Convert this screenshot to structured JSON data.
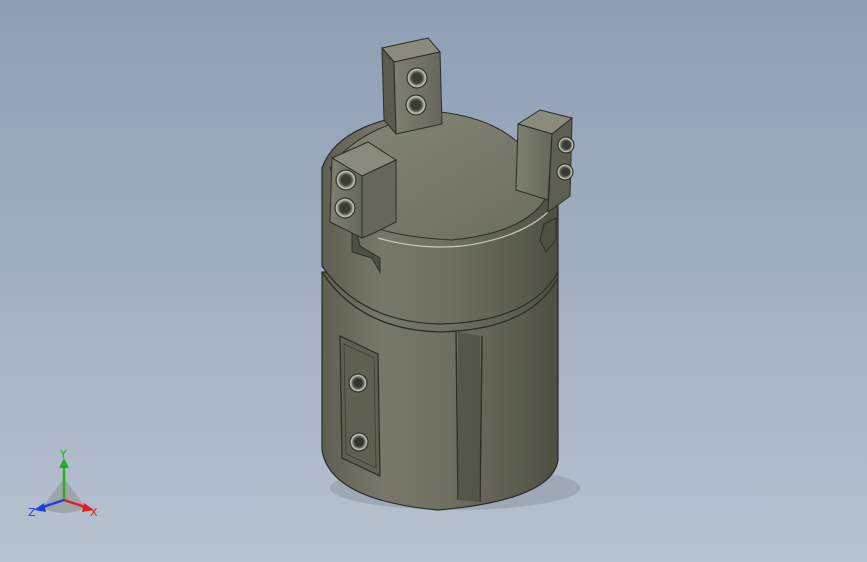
{
  "viewport": {
    "background_top": "#8f9fb4",
    "background_bottom": "#b7c2d0"
  },
  "model": {
    "body_color": "#6b6b5b",
    "body_shadow": "#55564a",
    "body_highlight": "#8c8c7a",
    "top_face_color": "#7b7b6b",
    "jaw_color": "#7a7a6c"
  },
  "triad": {
    "x_label": "X",
    "y_label": "Y",
    "z_label": "Z",
    "x_color": "#e02020",
    "y_color": "#20b020",
    "z_color": "#2040e0"
  }
}
